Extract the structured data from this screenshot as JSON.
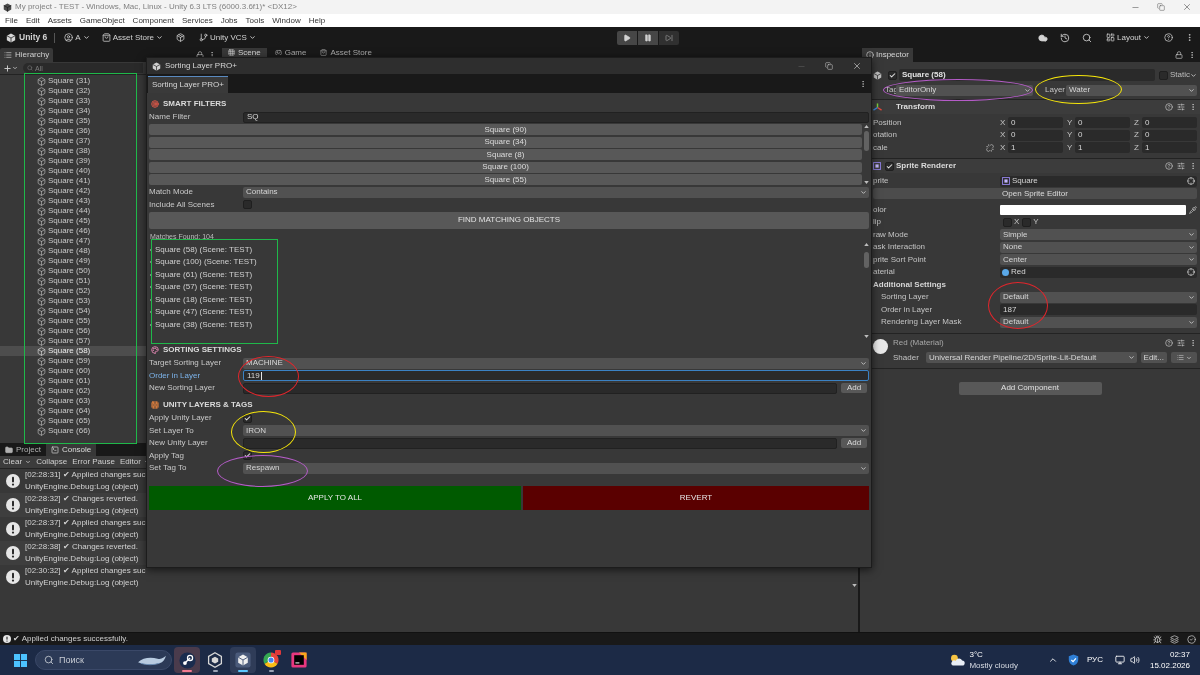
{
  "title_bar": {
    "title": "My project - TEST - Windows, Mac, Linux - Unity 6.3 LTS (6000.3.6f1)* <DX12>"
  },
  "menu_bar": [
    "File",
    "Edit",
    "Assets",
    "GameObject",
    "Component",
    "Services",
    "Jobs",
    "Tools",
    "Window",
    "Help"
  ],
  "toolbar": {
    "product": "Unity 6",
    "account": "A",
    "asset_store": "Asset Store",
    "vcs": "Unity VCS",
    "layout": "Layout"
  },
  "hierarchy": {
    "title": "Hierarchy",
    "search_placeholder": "All",
    "items": [
      {
        "label": "Square (31)",
        "selected": false
      },
      {
        "label": "Square (32)",
        "selected": false
      },
      {
        "label": "Square (33)",
        "selected": false
      },
      {
        "label": "Square (34)",
        "selected": false
      },
      {
        "label": "Square (35)",
        "selected": false
      },
      {
        "label": "Square (36)",
        "selected": false
      },
      {
        "label": "Square (37)",
        "selected": false
      },
      {
        "label": "Square (38)",
        "selected": false
      },
      {
        "label": "Square (39)",
        "selected": false
      },
      {
        "label": "Square (40)",
        "selected": false
      },
      {
        "label": "Square (41)",
        "selected": false
      },
      {
        "label": "Square (42)",
        "selected": false
      },
      {
        "label": "Square (43)",
        "selected": false
      },
      {
        "label": "Square (44)",
        "selected": false
      },
      {
        "label": "Square (45)",
        "selected": false
      },
      {
        "label": "Square (46)",
        "selected": false
      },
      {
        "label": "Square (47)",
        "selected": false
      },
      {
        "label": "Square (48)",
        "selected": false
      },
      {
        "label": "Square (49)",
        "selected": false
      },
      {
        "label": "Square (50)",
        "selected": false
      },
      {
        "label": "Square (51)",
        "selected": false
      },
      {
        "label": "Square (52)",
        "selected": false
      },
      {
        "label": "Square (53)",
        "selected": false
      },
      {
        "label": "Square (54)",
        "selected": false
      },
      {
        "label": "Square (55)",
        "selected": false
      },
      {
        "label": "Square (56)",
        "selected": false
      },
      {
        "label": "Square (57)",
        "selected": false
      },
      {
        "label": "Square (58)",
        "selected": true
      },
      {
        "label": "Square (59)",
        "selected": false
      },
      {
        "label": "Square (60)",
        "selected": false
      },
      {
        "label": "Square (61)",
        "selected": false
      },
      {
        "label": "Square (62)",
        "selected": false
      },
      {
        "label": "Square (63)",
        "selected": false
      },
      {
        "label": "Square (64)",
        "selected": false
      },
      {
        "label": "Square (65)",
        "selected": false
      },
      {
        "label": "Square (66)",
        "selected": false
      }
    ]
  },
  "scene_tabs": [
    {
      "label": "Scene",
      "selected": true
    },
    {
      "label": "Game",
      "selected": false
    },
    {
      "label": "Asset Store",
      "selected": false
    }
  ],
  "console": {
    "tabs": [
      {
        "label": "Project",
        "selected": false
      },
      {
        "label": "Console",
        "selected": true
      }
    ],
    "toolbar": [
      {
        "label": "Clear",
        "kind": "dropdown"
      },
      {
        "label": "Collapse",
        "kind": "toggle"
      },
      {
        "label": "Error Pause",
        "kind": "toggle"
      },
      {
        "label": "Editor",
        "kind": "dropdown"
      }
    ],
    "entries": [
      {
        "message": "[02:28:31] ✔ Applied changes suc",
        "source": "UnityEngine.Debug:Log (object)"
      },
      {
        "message": "[02:28:32] ✔ Changes reverted.",
        "source": "UnityEngine.Debug:Log (object)"
      },
      {
        "message": "[02:28:37] ✔ Applied changes suc",
        "source": "UnityEngine.Debug:Log (object)"
      },
      {
        "message": "[02:28:38] ✔ Changes reverted.",
        "source": "UnityEngine.Debug:Log (object)"
      },
      {
        "message": "[02:30:32] ✔ Applied changes suc",
        "source": "UnityEngine.Debug:Log (object)"
      }
    ]
  },
  "sorting_window": {
    "title": "Sorting Layer PRO+",
    "tab": "Sorting Layer PRO+",
    "rows": [
      {
        "kind": "heading",
        "label": "SMART FILTERS"
      },
      {
        "kind": "field",
        "label": "Name Filter",
        "value": "SQ",
        "focused": false
      },
      {
        "kind": "suggestions",
        "items": [
          "Square (90)",
          "Square (34)",
          "Square (8)",
          "Square (100)",
          "Square (55)"
        ]
      },
      {
        "kind": "dropdown",
        "label": "Match Mode",
        "value": "Contains"
      },
      {
        "kind": "checkbox",
        "label": "Include All Scenes",
        "checked": false
      },
      {
        "kind": "button",
        "label": "FIND MATCHING OBJECTS"
      },
      {
        "kind": "matches",
        "label": "Matches Found: 104",
        "items": [
          "Square (58) (Scene: TEST)",
          "Square (100) (Scene: TEST)",
          "Square (61) (Scene: TEST)",
          "Square (57) (Scene: TEST)",
          "Square (18) (Scene: TEST)",
          "Square (47) (Scene: TEST)",
          "Square (38) (Scene: TEST)"
        ]
      },
      {
        "kind": "heading",
        "label": "SORTING SETTINGS"
      },
      {
        "kind": "dropdown",
        "label": "Target Sorting Layer",
        "value": "MACHINE"
      },
      {
        "kind": "field",
        "label": "Order in Layer",
        "value": "119",
        "focused": true
      },
      {
        "kind": "field",
        "label": "New Sorting Layer",
        "focused": false,
        "button": "Add"
      },
      {
        "kind": "heading",
        "label": "UNITY LAYERS & TAGS"
      },
      {
        "kind": "checkbox",
        "label": "Apply Unity Layer",
        "checked": true
      },
      {
        "kind": "dropdown",
        "label": "Set Layer To",
        "value": "IRON"
      },
      {
        "kind": "field",
        "label": "New Unity Layer",
        "focused": false,
        "button": "Add"
      },
      {
        "kind": "checkbox",
        "label": "Apply Tag",
        "checked": true
      },
      {
        "kind": "dropdown",
        "label": "Set Tag To",
        "value": "Respawn"
      },
      {
        "kind": "actions",
        "buttons": [
          {
            "label": "APPLY TO ALL",
            "color": "#005a00"
          },
          {
            "label": "REVERT",
            "color": "#5a0000"
          }
        ]
      }
    ]
  },
  "inspector": {
    "title": "Inspector",
    "object": {
      "active": true,
      "name": "Square (58)",
      "static": false,
      "static_label": "Static",
      "tag_label": "Tag",
      "tag": "EditorOnly",
      "layer_label": "Layer",
      "layer": "Water"
    },
    "transform": {
      "title": "Transform",
      "rows": [
        {
          "kind": "vector",
          "label": "Position",
          "axes": [
            {
              "axis": "X",
              "value": "0"
            },
            {
              "axis": "Y",
              "value": "0"
            },
            {
              "axis": "Z",
              "value": "0"
            }
          ]
        },
        {
          "kind": "vector",
          "label": "otation",
          "axes": [
            {
              "axis": "X",
              "value": "0"
            },
            {
              "axis": "Y",
              "value": "0"
            },
            {
              "axis": "Z",
              "value": "0"
            }
          ]
        },
        {
          "kind": "linkable",
          "label": "cale",
          "axes": [
            {
              "axis": "X",
              "value": "1"
            },
            {
              "axis": "Y",
              "value": "1"
            },
            {
              "axis": "Z",
              "value": "1"
            }
          ]
        }
      ]
    },
    "sprite_renderer": {
      "title": "Sprite Renderer",
      "enabled": true,
      "rows": [
        {
          "kind": "sprite",
          "label": "prite",
          "value": "Square"
        },
        {
          "kind": "button",
          "label": "Open Sprite Editor"
        },
        {
          "kind": "color",
          "label": "olor",
          "color": "#ffffff"
        },
        {
          "kind": "flip",
          "label": "lip",
          "options": [
            {
              "label": "X",
              "checked": false
            },
            {
              "label": "Y",
              "checked": false
            }
          ]
        },
        {
          "kind": "dropdown",
          "label": "raw Mode",
          "value": "Simple"
        },
        {
          "kind": "dropdown",
          "label": "ask Interaction",
          "value": "None"
        },
        {
          "kind": "dropdown",
          "label": "prite Sort Point",
          "value": "Center"
        },
        {
          "kind": "material",
          "label": "aterial",
          "value": "Red"
        },
        {
          "kind": "group",
          "label": "Additional Settings",
          "children": [
            {
              "kind": "dropdown",
              "label": "Sorting Layer",
              "value": "Default"
            },
            {
              "kind": "field",
              "label": "Order in Layer",
              "value": "187"
            },
            {
              "kind": "dropdown",
              "label": "Rendering Layer Mask",
              "value": "Default"
            }
          ]
        }
      ]
    },
    "material": {
      "name": "Red (Material)",
      "shader_label": "Shader",
      "shader": "Universal Render Pipeline/2D/Sprite-Lit-Default",
      "edit": "Edit..."
    },
    "add_component": "Add Component"
  },
  "status_bar": {
    "message": "✔ Applied changes successfully."
  },
  "taskbar": {
    "search_placeholder": "Поиск",
    "apps": [
      {
        "kind": "disc",
        "active": false,
        "attention": true,
        "running": true,
        "badge": false
      },
      {
        "kind": "hexagon",
        "active": false,
        "attention": false,
        "running": true,
        "badge": false
      },
      {
        "kind": "cube",
        "active": true,
        "attention": false,
        "running": true,
        "badge": false
      },
      {
        "kind": "ring",
        "active": false,
        "attention": false,
        "running": true,
        "badge": true
      },
      {
        "kind": "tile",
        "active": false,
        "attention": false,
        "running": false,
        "badge": false
      }
    ],
    "weather": {
      "temperature": "3°C",
      "condition": "Mostly cloudy"
    },
    "language": "РУС",
    "time": "02:37",
    "date": "15.02.2026"
  },
  "annotations": [
    {
      "kind": "rect",
      "color": "#1fb84a"
    },
    {
      "kind": "rect",
      "color": "#1fb84a"
    },
    {
      "kind": "ellipse",
      "color": "#e0262c"
    },
    {
      "kind": "ellipse",
      "color": "#f5e50a"
    },
    {
      "kind": "ellipse",
      "color": "#b55cc8"
    },
    {
      "kind": "ellipse",
      "color": "#b55cc8"
    },
    {
      "kind": "ellipse",
      "color": "#f5e50a"
    },
    {
      "kind": "ellipse",
      "color": "#e0262c"
    }
  ]
}
